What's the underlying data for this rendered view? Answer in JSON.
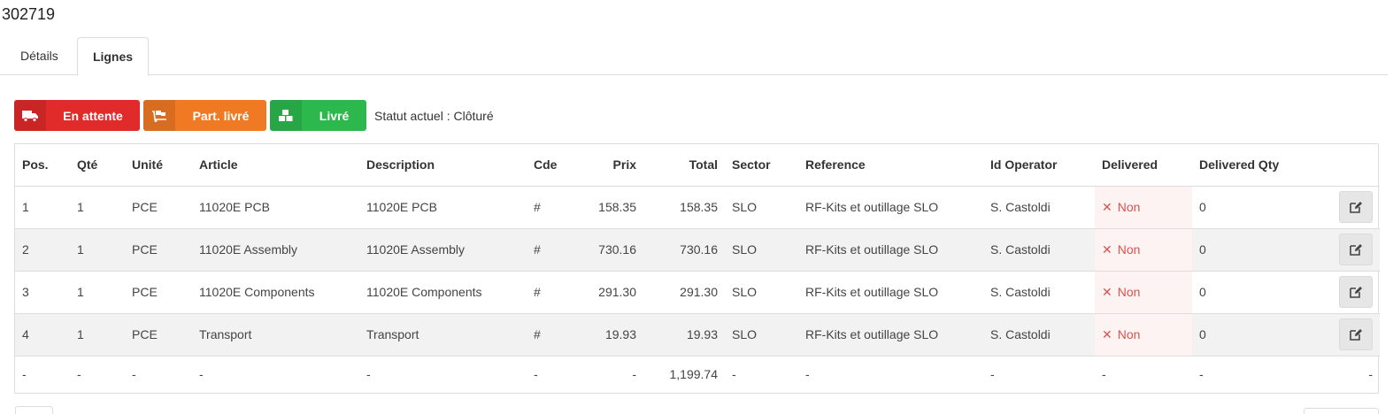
{
  "order": {
    "number": "302719"
  },
  "tabs": [
    {
      "label": "Détails"
    },
    {
      "label": "Lignes"
    }
  ],
  "status": {
    "buttons": [
      {
        "label": "En attente",
        "icon": "truck-icon",
        "color": "#e12a2a"
      },
      {
        "label": "Part. livré",
        "icon": "dolly-icon",
        "color": "#f07a24"
      },
      {
        "label": "Livré",
        "icon": "boxes-icon",
        "color": "#2db84d"
      }
    ],
    "current_text": "Statut actuel : Clôturé"
  },
  "table": {
    "headers": [
      "Pos.",
      "Qté",
      "Unité",
      "Article",
      "Description",
      "Cde",
      "Prix",
      "Total",
      "Sector",
      "Reference",
      "Id Operator",
      "Delivered",
      "Delivered Qty"
    ],
    "rows": [
      {
        "pos": "1",
        "qty": "1",
        "unit": "PCE",
        "article": "11020E PCB",
        "description": "11020E PCB",
        "cde": "#",
        "price": "158.35",
        "total": "158.35",
        "sector": "SLO",
        "reference": "RF-Kits et outillage SLO",
        "operator": "S. Castoldi",
        "delivered": "Non",
        "delivered_qty": "0"
      },
      {
        "pos": "2",
        "qty": "1",
        "unit": "PCE",
        "article": "11020E Assembly",
        "description": "11020E Assembly",
        "cde": "#",
        "price": "730.16",
        "total": "730.16",
        "sector": "SLO",
        "reference": "RF-Kits et outillage SLO",
        "operator": "S. Castoldi",
        "delivered": "Non",
        "delivered_qty": "0"
      },
      {
        "pos": "3",
        "qty": "1",
        "unit": "PCE",
        "article": "11020E Components",
        "description": "11020E Components",
        "cde": "#",
        "price": "291.30",
        "total": "291.30",
        "sector": "SLO",
        "reference": "RF-Kits et outillage SLO",
        "operator": "S. Castoldi",
        "delivered": "Non",
        "delivered_qty": "0"
      },
      {
        "pos": "4",
        "qty": "1",
        "unit": "PCE",
        "article": "Transport",
        "description": "Transport",
        "cde": "#",
        "price": "19.93",
        "total": "19.93",
        "sector": "SLO",
        "reference": "RF-Kits et outillage SLO",
        "operator": "S. Castoldi",
        "delivered": "Non",
        "delivered_qty": "0"
      }
    ],
    "footer": {
      "pos": "-",
      "qty": "-",
      "unit": "-",
      "article": "-",
      "description": "-",
      "cde": "-",
      "price": "-",
      "total": "1,199.74",
      "sector": "-",
      "reference": "-",
      "operator": "-",
      "delivered": "-",
      "delivered_qty": "-",
      "action": "-"
    }
  }
}
